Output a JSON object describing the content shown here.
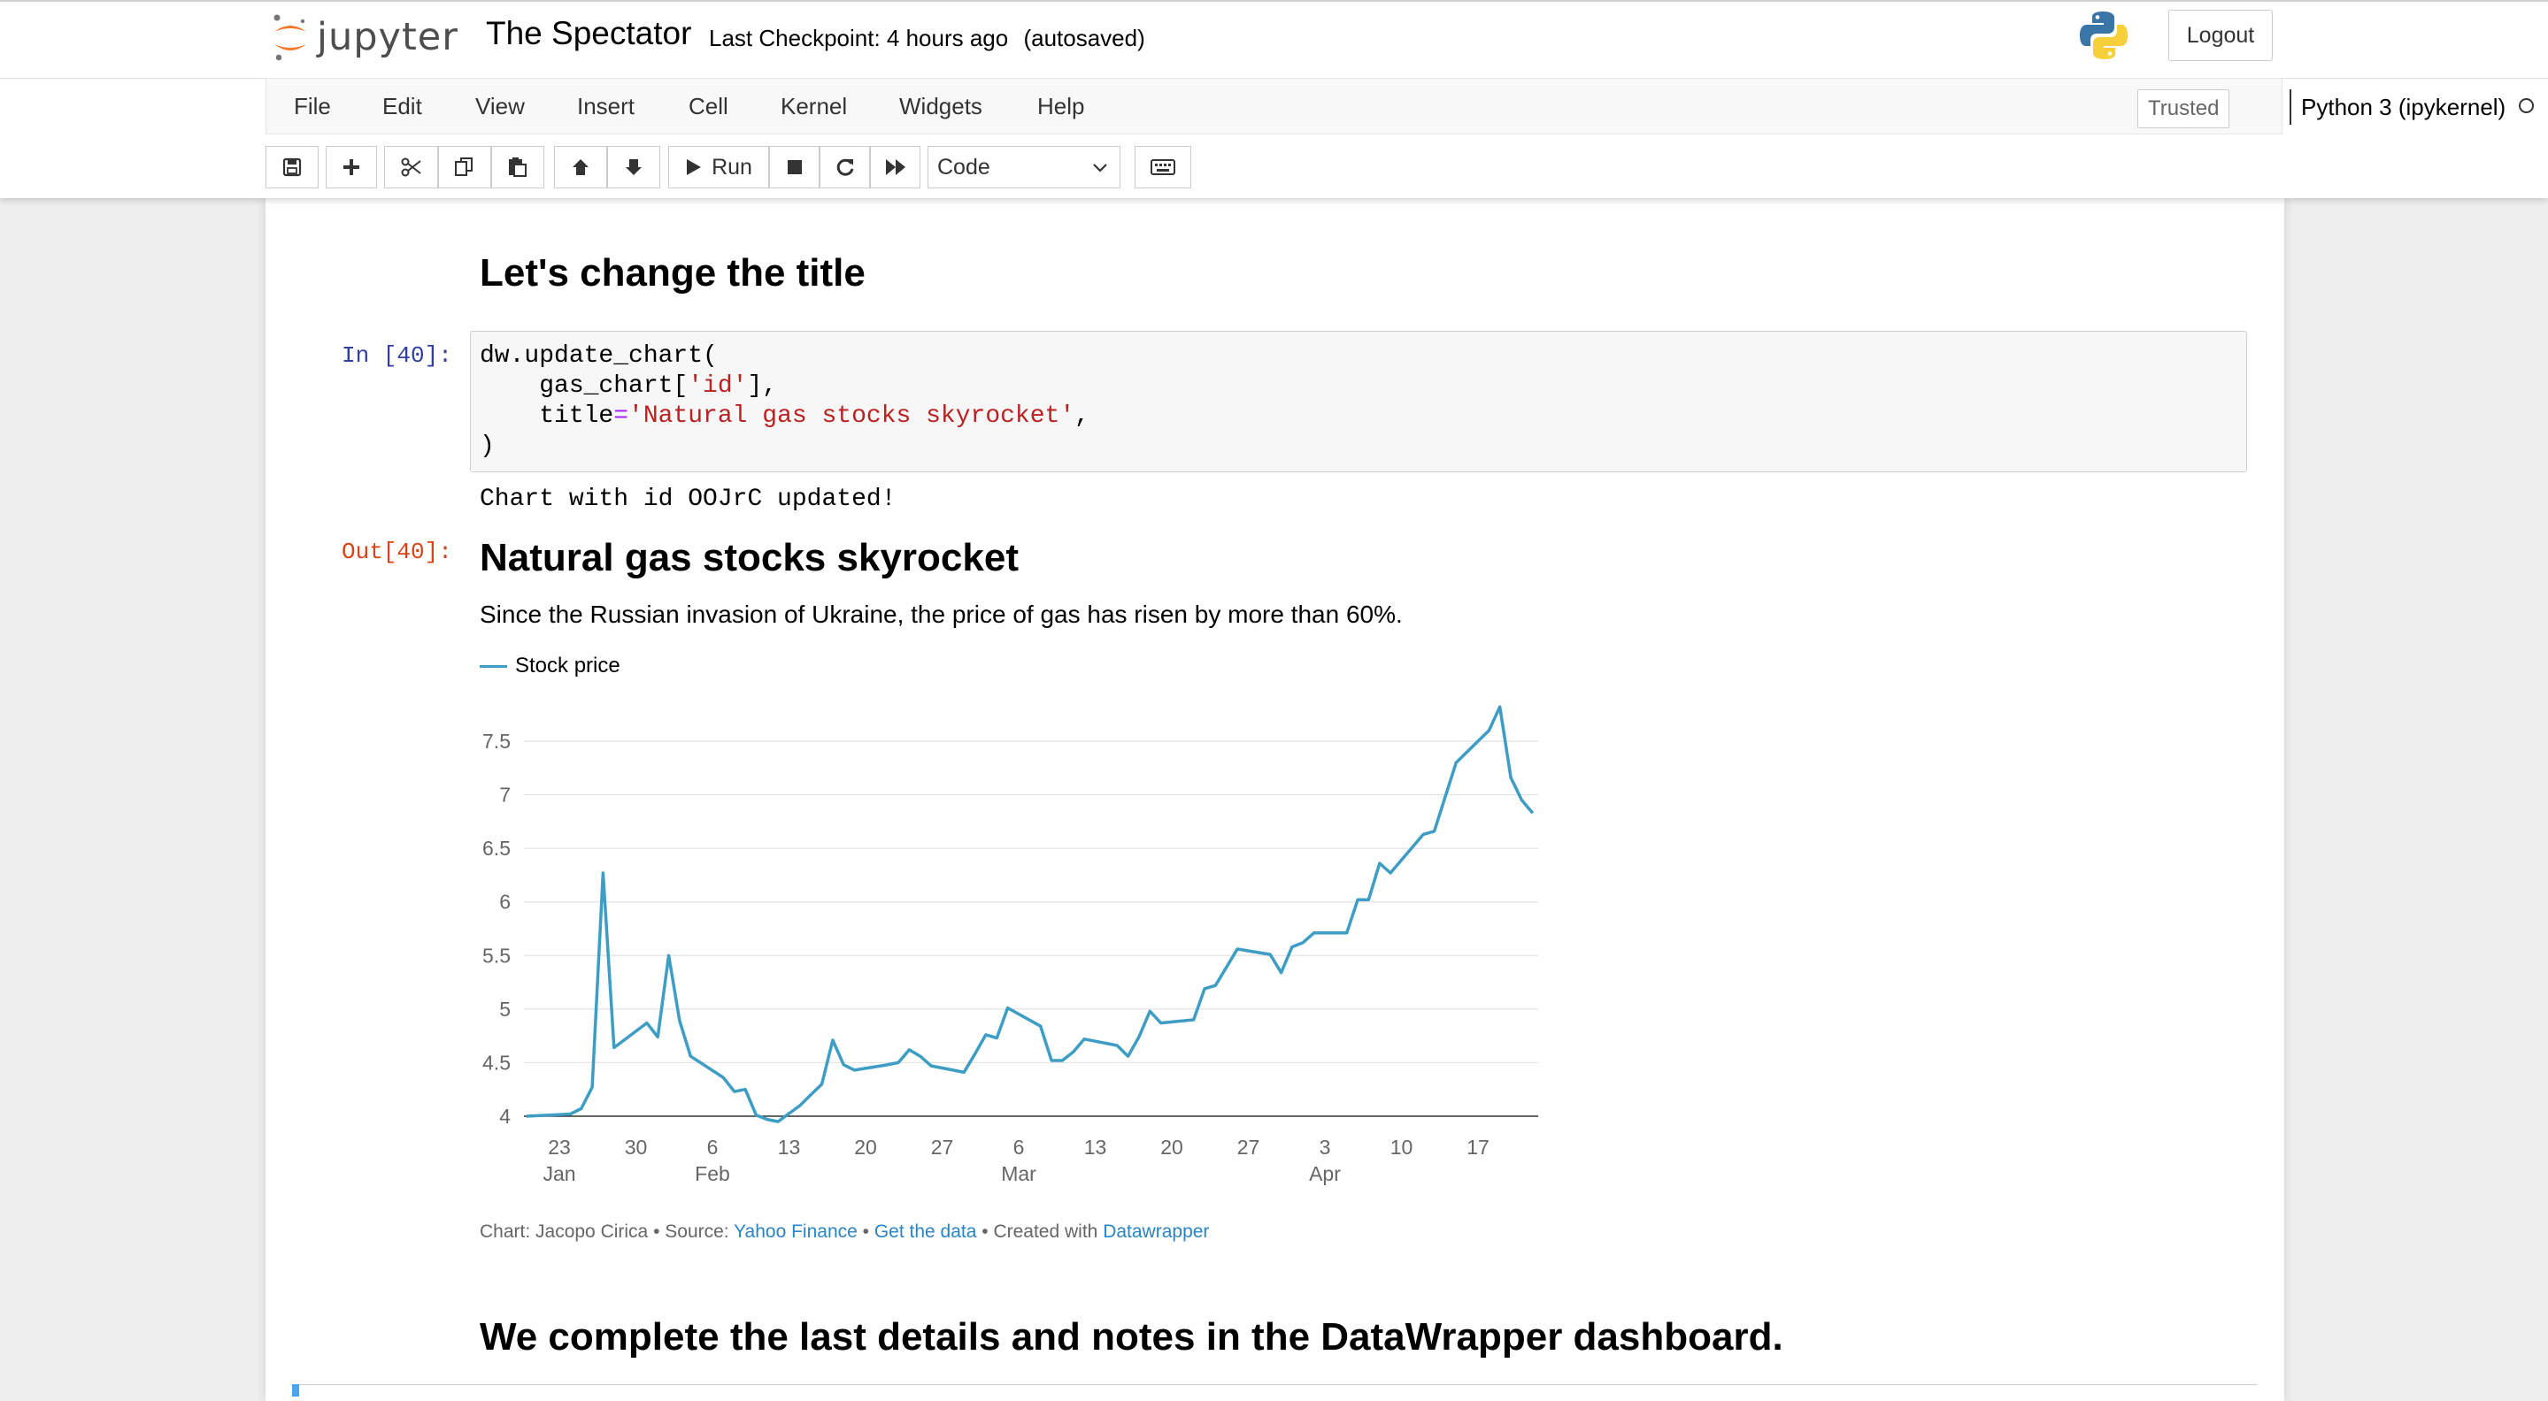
{
  "header": {
    "logo_text": "jupyter",
    "notebook_title": "The Spectator",
    "checkpoint": "Last Checkpoint: 4 hours ago",
    "autosave": "(autosaved)",
    "logout_label": "Logout"
  },
  "menu": {
    "items": [
      "File",
      "Edit",
      "View",
      "Insert",
      "Cell",
      "Kernel",
      "Widgets",
      "Help"
    ],
    "trusted_label": "Trusted",
    "kernel_name": "Python 3 (ipykernel)"
  },
  "toolbar": {
    "run_label": "Run",
    "cell_type": "Code",
    "icons": [
      "save-icon",
      "plus-icon",
      "cut-icon",
      "copy-icon",
      "paste-icon",
      "arrow-up-icon",
      "arrow-down-icon",
      "play-icon",
      "stop-icon",
      "restart-icon",
      "fast-forward-icon",
      "keyboard-icon"
    ]
  },
  "cells": {
    "heading1": "Let's change the title",
    "in_prompt": "In [40]:",
    "code": {
      "line1": "dw.update_chart(",
      "line2_pre": "    gas_chart[",
      "line2_str": "'id'",
      "line2_post": "],",
      "line3_pre": "    title",
      "line3_op": "=",
      "line3_str": "'Natural gas stocks skyrocket'",
      "line3_post": ",",
      "line4": ")"
    },
    "stdout": "Chart with id OOJrC updated!",
    "out_prompt": "Out[40]:",
    "heading2": "We complete the last details and notes in the DataWrapper dashboard."
  },
  "chart": {
    "footer_prefix": "Chart: Jacopo Cirica • Source: ",
    "footer_source": "Yahoo Finance",
    "footer_sep": " • ",
    "footer_get_data": "Get the data",
    "footer_created": " • Created with ",
    "footer_tool": "Datawrapper"
  },
  "chart_data": {
    "type": "line",
    "title": "Natural gas stocks skyrocket",
    "subtitle": "Since the Russian invasion of Ukraine, the price of gas has risen by more than 60%.",
    "legend": [
      "Stock price"
    ],
    "series": [
      {
        "name": "Stock price",
        "color": "#3d9dc4",
        "points": [
          [
            "2022-01-20",
            4.0
          ],
          [
            "2022-01-24",
            4.02
          ],
          [
            "2022-01-25",
            4.07
          ],
          [
            "2022-01-26",
            4.27
          ],
          [
            "2022-01-27",
            6.27
          ],
          [
            "2022-01-28",
            4.64
          ],
          [
            "2022-01-31",
            4.87
          ],
          [
            "2022-02-01",
            4.74
          ],
          [
            "2022-02-02",
            5.5
          ],
          [
            "2022-02-03",
            4.89
          ],
          [
            "2022-02-04",
            4.56
          ],
          [
            "2022-02-07",
            4.36
          ],
          [
            "2022-02-08",
            4.23
          ],
          [
            "2022-02-09",
            4.25
          ],
          [
            "2022-02-10",
            4.01
          ],
          [
            "2022-02-11",
            3.97
          ],
          [
            "2022-02-12",
            3.95
          ],
          [
            "2022-02-14",
            4.1
          ],
          [
            "2022-02-15",
            4.2
          ],
          [
            "2022-02-16",
            4.3
          ],
          [
            "2022-02-17",
            4.71
          ],
          [
            "2022-02-18",
            4.48
          ],
          [
            "2022-02-19",
            4.43
          ],
          [
            "2022-02-22",
            4.48
          ],
          [
            "2022-02-23",
            4.5
          ],
          [
            "2022-02-24",
            4.62
          ],
          [
            "2022-02-25",
            4.56
          ],
          [
            "2022-02-26",
            4.47
          ],
          [
            "2022-02-28",
            4.43
          ],
          [
            "2022-03-01",
            4.41
          ],
          [
            "2022-03-02",
            4.58
          ],
          [
            "2022-03-03",
            4.76
          ],
          [
            "2022-03-04",
            4.73
          ],
          [
            "2022-03-05",
            5.01
          ],
          [
            "2022-03-08",
            4.84
          ],
          [
            "2022-03-09",
            4.52
          ],
          [
            "2022-03-10",
            4.52
          ],
          [
            "2022-03-11",
            4.6
          ],
          [
            "2022-03-12",
            4.72
          ],
          [
            "2022-03-15",
            4.66
          ],
          [
            "2022-03-16",
            4.56
          ],
          [
            "2022-03-17",
            4.74
          ],
          [
            "2022-03-18",
            4.98
          ],
          [
            "2022-03-19",
            4.87
          ],
          [
            "2022-03-22",
            4.9
          ],
          [
            "2022-03-23",
            5.19
          ],
          [
            "2022-03-24",
            5.22
          ],
          [
            "2022-03-26",
            5.56
          ],
          [
            "2022-03-29",
            5.51
          ],
          [
            "2022-03-30",
            5.34
          ],
          [
            "2022-03-31",
            5.58
          ],
          [
            "2022-04-01",
            5.62
          ],
          [
            "2022-04-02",
            5.71
          ],
          [
            "2022-04-05",
            5.71
          ],
          [
            "2022-04-06",
            6.02
          ],
          [
            "2022-04-07",
            6.02
          ],
          [
            "2022-04-08",
            6.36
          ],
          [
            "2022-04-09",
            6.27
          ],
          [
            "2022-04-12",
            6.63
          ],
          [
            "2022-04-13",
            6.66
          ],
          [
            "2022-04-15",
            7.3
          ],
          [
            "2022-04-18",
            7.6
          ],
          [
            "2022-04-19",
            7.82
          ],
          [
            "2022-04-20",
            7.16
          ],
          [
            "2022-04-21",
            6.95
          ],
          [
            "2022-04-22",
            6.83
          ]
        ]
      }
    ],
    "y_ticks": [
      4,
      4.5,
      5,
      5.5,
      6,
      6.5,
      7,
      7.5
    ],
    "y_tick_labels": [
      "4",
      "4.5",
      "5",
      "5.5",
      "6",
      "6.5",
      "7",
      "7.5"
    ],
    "ylim": [
      4,
      7.5
    ],
    "x_ticks": [
      {
        "date": "2022-01-23",
        "label": "23",
        "sub": "Jan"
      },
      {
        "date": "2022-01-30",
        "label": "30",
        "sub": ""
      },
      {
        "date": "2022-02-06",
        "label": "6",
        "sub": "Feb"
      },
      {
        "date": "2022-02-13",
        "label": "13",
        "sub": ""
      },
      {
        "date": "2022-02-20",
        "label": "20",
        "sub": ""
      },
      {
        "date": "2022-02-27",
        "label": "27",
        "sub": ""
      },
      {
        "date": "2022-03-06",
        "label": "6",
        "sub": "Mar"
      },
      {
        "date": "2022-03-13",
        "label": "13",
        "sub": ""
      },
      {
        "date": "2022-03-20",
        "label": "20",
        "sub": ""
      },
      {
        "date": "2022-03-27",
        "label": "27",
        "sub": ""
      },
      {
        "date": "2022-04-03",
        "label": "3",
        "sub": "Apr"
      },
      {
        "date": "2022-04-10",
        "label": "10",
        "sub": ""
      },
      {
        "date": "2022-04-17",
        "label": "17",
        "sub": ""
      }
    ],
    "grid": true
  }
}
